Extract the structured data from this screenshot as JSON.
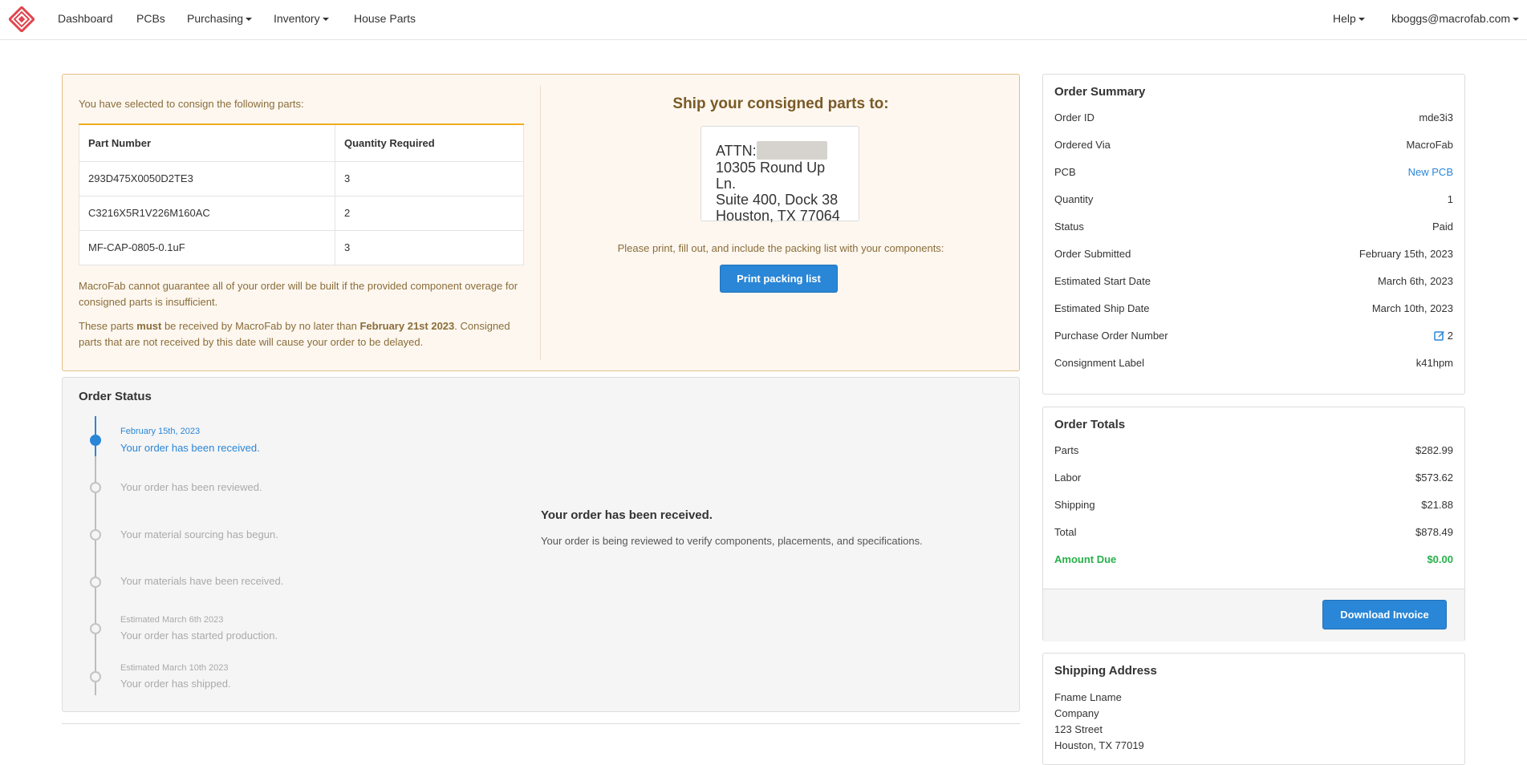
{
  "nav": {
    "items": [
      {
        "label": "Dashboard"
      },
      {
        "label": "PCBs"
      },
      {
        "label": "Purchasing"
      },
      {
        "label": "Inventory"
      },
      {
        "label": "House Parts"
      }
    ],
    "help": "Help",
    "user": "kboggs@macrofab.com"
  },
  "consign": {
    "intro": "You have selected to consign the following parts:",
    "table": {
      "headers": [
        "Part Number",
        "Quantity Required"
      ],
      "rows": [
        {
          "part": "293D475X0050D2TE3",
          "qty": "3"
        },
        {
          "part": "C3216X5R1V226M160AC",
          "qty": "2"
        },
        {
          "part": "MF-CAP-0805-0.1uF",
          "qty": "3"
        }
      ]
    },
    "note1": "MacroFab cannot guarantee all of your order will be built if the provided component overage for consigned parts is insufficient.",
    "note2_a": "These parts ",
    "note2_b": "must",
    "note2_c": " be received by MacroFab by no later than ",
    "note2_date": "February 21st 2023",
    "note2_d": ". Consigned parts that are not received by this date will cause your order to be delayed.",
    "ship_title": "Ship your consigned parts to:",
    "address": {
      "attn": "ATTN:",
      "line1": "10305 Round Up Ln.",
      "line2": "Suite 400, Dock 38",
      "line3": "Houston, TX 77064"
    },
    "instructions": "Please print, fill out, and include the packing list with your components:",
    "print_button": "Print packing list"
  },
  "order_status": {
    "title": "Order Status",
    "steps": [
      {
        "date": "February 15th, 2023",
        "text": "Your order has been received.",
        "active": true
      },
      {
        "date": "",
        "text": "Your order has been reviewed.",
        "active": false
      },
      {
        "date": "",
        "text": "Your material sourcing has begun.",
        "active": false
      },
      {
        "date": "",
        "text": "Your materials have been received.",
        "active": false
      },
      {
        "date": "Estimated March 6th 2023",
        "text": "Your order has started production.",
        "active": false
      },
      {
        "date": "Estimated March 10th 2023",
        "text": "Your order has shipped.",
        "active": false
      }
    ],
    "current_heading": "Your order has been received.",
    "current_desc": "Your order is being reviewed to verify components, placements, and specifications."
  },
  "order_summary": {
    "title": "Order Summary",
    "rows": [
      {
        "label": "Order ID",
        "value": "mde3i3"
      },
      {
        "label": "Ordered Via",
        "value": "MacroFab"
      },
      {
        "label": "PCB",
        "value": "New PCB"
      },
      {
        "label": "Quantity",
        "value": "1"
      },
      {
        "label": "Status",
        "value": "Paid"
      },
      {
        "label": "Order Submitted",
        "value": "February 15th, 2023"
      },
      {
        "label": "Estimated Start Date",
        "value": "March 6th, 2023"
      },
      {
        "label": "Estimated Ship Date",
        "value": "March 10th, 2023"
      },
      {
        "label": "Purchase Order Number",
        "value": "2"
      },
      {
        "label": "Consignment Label",
        "value": "k41hpm"
      }
    ]
  },
  "order_totals": {
    "title": "Order Totals",
    "rows": [
      {
        "label": "Parts",
        "value": "$282.99"
      },
      {
        "label": "Labor",
        "value": "$573.62"
      },
      {
        "label": "Shipping",
        "value": "$21.88"
      },
      {
        "label": "Total",
        "value": "$878.49"
      },
      {
        "label": "Amount Due",
        "value": "$0.00"
      }
    ],
    "download_button": "Download Invoice"
  },
  "shipping_address": {
    "title": "Shipping Address",
    "lines": [
      "Fname Lname",
      "Company",
      "123 Street",
      "Houston, TX 77019"
    ]
  },
  "colors": {
    "accent": "#2a86d6",
    "warning_bg": "#fdf7ef",
    "warning_border": "#e2bf86",
    "success": "#28b04a",
    "brand": "#e0454f"
  }
}
